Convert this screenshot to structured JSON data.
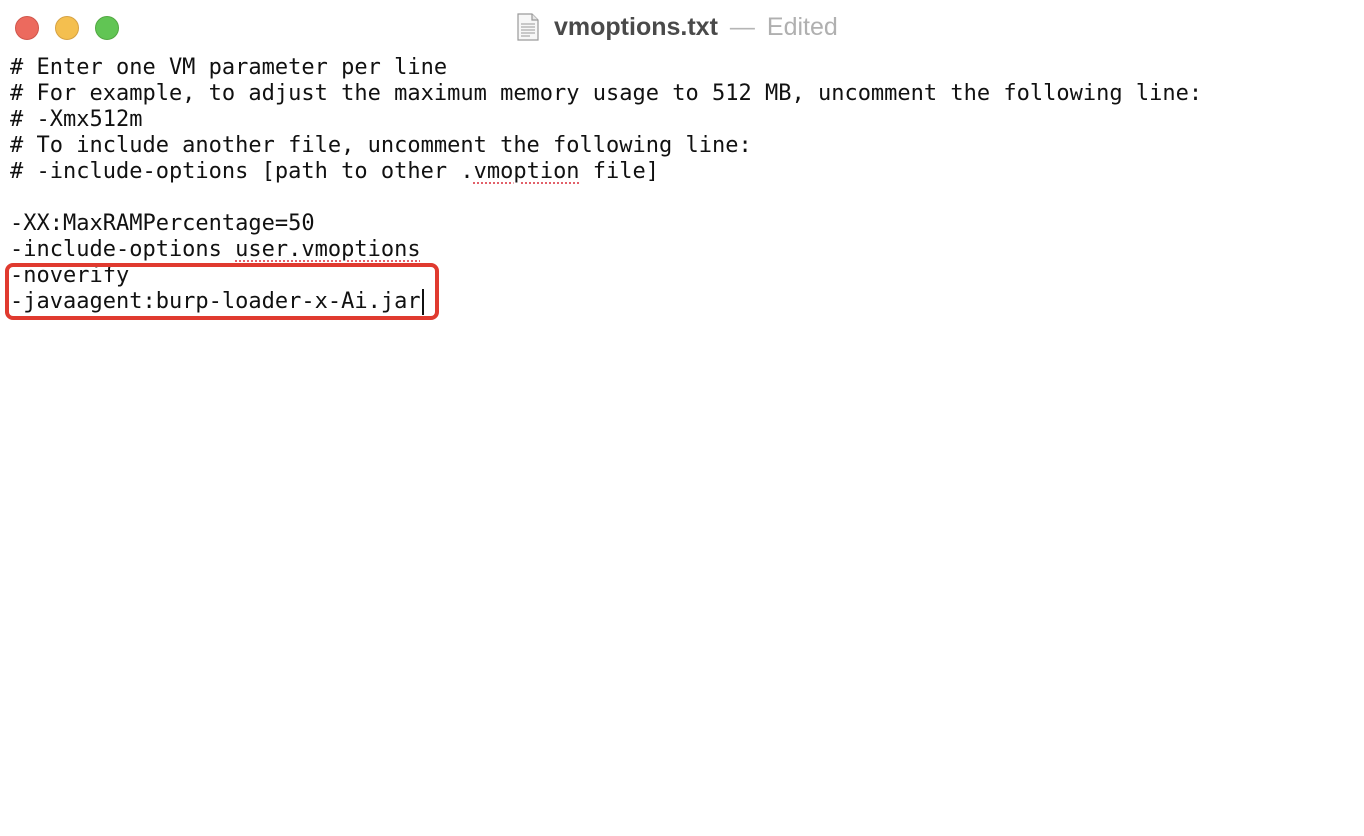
{
  "window": {
    "title": "vmoptions.txt",
    "separator": "—",
    "state": "Edited",
    "icon": "text-document-icon",
    "controls": [
      "close-button",
      "minimize-button",
      "zoom-button"
    ],
    "colors": {
      "close": "#ec6a5e",
      "minimize": "#f4bf4f",
      "zoom": "#61c554",
      "highlight": "#e03a2f"
    }
  },
  "editor": {
    "line1": "# Enter one VM parameter per line",
    "line2": "# For example, to adjust the maximum memory usage to 512 MB, uncomment the following line:",
    "line3": "# -Xmx512m",
    "line4": "# To include another file, uncomment the following line:",
    "line5_before": "# -include-options [path to other .",
    "line5_spell": "vmoption",
    "line5_after": " file]",
    "line6": "",
    "line7": "-XX:MaxRAMPercentage=50",
    "line8_before": "-include-options ",
    "line8_spell": "user.vmoptions",
    "line9": "-noverify",
    "line10": "-javaagent:burp-loader-x-Ai.jar"
  }
}
